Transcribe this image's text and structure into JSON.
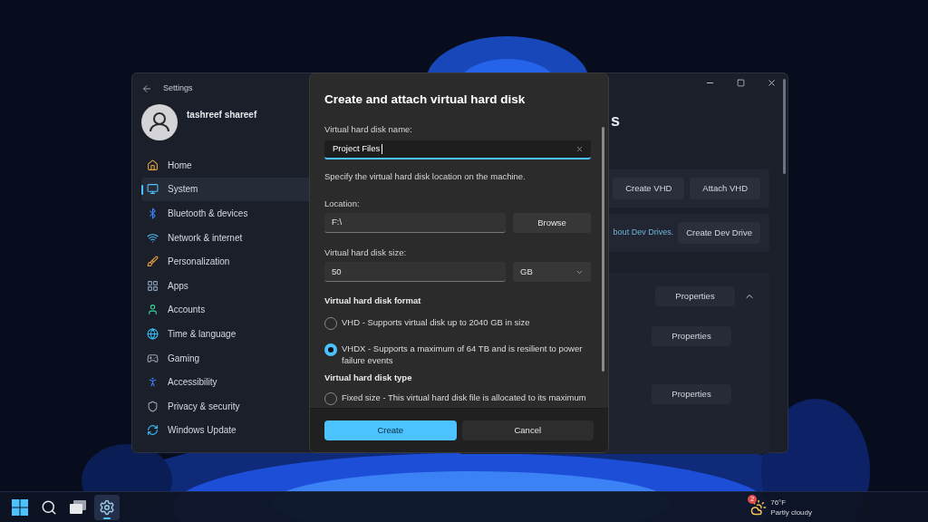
{
  "settings_window": {
    "title": "Settings",
    "user": "tashreef shareef",
    "nav": [
      {
        "label": "Home",
        "selected": false
      },
      {
        "label": "System",
        "selected": true
      },
      {
        "label": "Bluetooth & devices",
        "selected": false
      },
      {
        "label": "Network & internet",
        "selected": false
      },
      {
        "label": "Personalization",
        "selected": false
      },
      {
        "label": "Apps",
        "selected": false
      },
      {
        "label": "Accounts",
        "selected": false
      },
      {
        "label": "Time & language",
        "selected": false
      },
      {
        "label": "Gaming",
        "selected": false
      },
      {
        "label": "Accessibility",
        "selected": false
      },
      {
        "label": "Privacy & security",
        "selected": false
      },
      {
        "label": "Windows Update",
        "selected": false
      }
    ],
    "page_title": "s",
    "vhd_buttons": [
      "Create VHD",
      "Attach VHD"
    ],
    "dev_drive": {
      "link": "bout Dev Drives.",
      "button": "Create Dev Drive"
    },
    "volumes_expanded": true,
    "volume_buttons": [
      "Properties",
      "Properties",
      "Properties"
    ]
  },
  "dialog": {
    "title": "Create and attach virtual hard disk",
    "name_field": {
      "label": "Virtual hard disk name:",
      "value": "Project Files"
    },
    "location_hint": "Specify the virtual hard disk location on the machine.",
    "location": {
      "label": "Location:",
      "value": "F:\\",
      "button": "Browse"
    },
    "size": {
      "label": "Virtual hard disk size:",
      "value": "50",
      "unit": "GB"
    },
    "format_heading": "Virtual hard disk format",
    "format_options": [
      {
        "label": "VHD - Supports virtual disk up to 2040 GB in size",
        "selected": false
      },
      {
        "label": "VHDX - Supports a maximum of 64 TB and is resilient to power failure events",
        "selected": true
      }
    ],
    "type_heading": "Virtual hard disk type",
    "type_options": [
      {
        "label": "Fixed size - This virtual hard disk file is allocated to its maximum",
        "selected": false
      }
    ],
    "primary_button": "Create",
    "secondary_button": "Cancel"
  },
  "taskbar": {
    "apps": [
      {
        "kind": "start",
        "active": false
      },
      {
        "kind": "search",
        "active": false
      },
      {
        "kind": "taskview",
        "active": false
      },
      {
        "kind": "settings",
        "active": true
      }
    ],
    "weather": {
      "badge": "2",
      "temperature": "76°F",
      "condition": "Partly cloudy"
    }
  }
}
